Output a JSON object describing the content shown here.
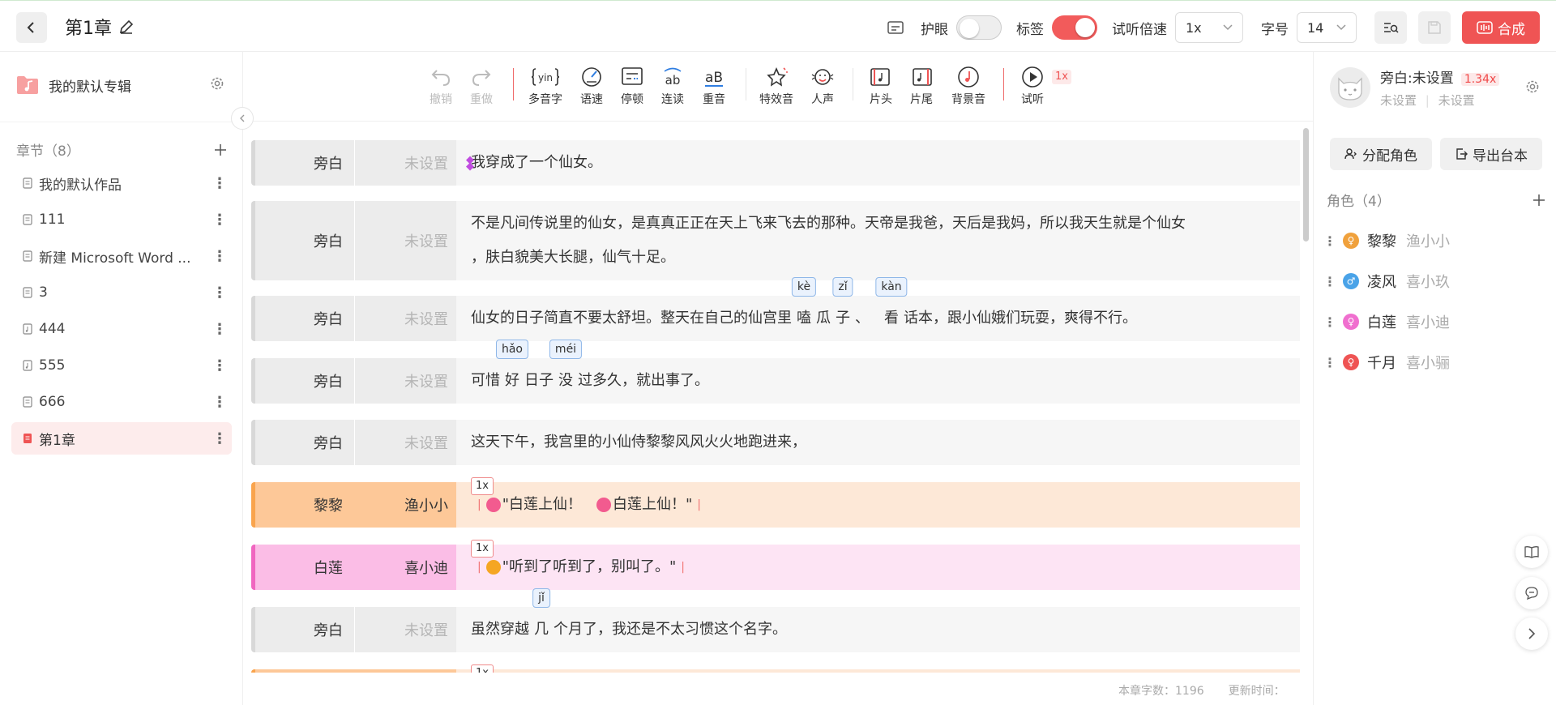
{
  "header": {
    "title": "第1章",
    "eye_label": "护眼",
    "eye_on": false,
    "tag_label": "标签",
    "tag_on": true,
    "speed_label": "试听倍速",
    "speed_value": "1x",
    "font_label": "字号",
    "font_value": "14",
    "synth_label": "合成",
    "accent": "#ef5454"
  },
  "sidebar": {
    "album_name": "我的默认专辑",
    "chapters_label": "章节（8）",
    "chapters": [
      {
        "name": "我的默认作品",
        "active": false
      },
      {
        "name": "111",
        "active": false
      },
      {
        "name": "新建 Microsoft Word ...",
        "active": false
      },
      {
        "name": "3",
        "active": false
      },
      {
        "name": "444",
        "active": false
      },
      {
        "name": "555",
        "active": false
      },
      {
        "name": "666",
        "active": false
      },
      {
        "name": "第1章",
        "active": true
      }
    ]
  },
  "toolbar": {
    "tools": [
      {
        "label": "撤销",
        "icon": "undo-icon",
        "disabled": true
      },
      {
        "label": "重做",
        "icon": "redo-icon",
        "disabled": true
      },
      {
        "label": "多音字",
        "icon": "polyphone-icon",
        "disabled": false
      },
      {
        "label": "语速",
        "icon": "speed-icon",
        "disabled": false
      },
      {
        "label": "停顿",
        "icon": "pause-icon",
        "disabled": false
      },
      {
        "label": "连读",
        "icon": "liaison-icon",
        "disabled": false
      },
      {
        "label": "重音",
        "icon": "stress-icon",
        "disabled": false
      },
      {
        "label": "特效音",
        "icon": "sound-effect-icon",
        "disabled": false
      },
      {
        "label": "人声",
        "icon": "voice-icon",
        "disabled": false
      },
      {
        "label": "片头",
        "icon": "intro-icon",
        "disabled": false
      },
      {
        "label": "片尾",
        "icon": "outro-icon",
        "disabled": false
      },
      {
        "label": "背景音",
        "icon": "bgm-icon",
        "disabled": false
      },
      {
        "label": "试听",
        "icon": "play-icon",
        "disabled": false
      }
    ],
    "preview_speed": "1x"
  },
  "editor": {
    "rows": [
      {
        "role": "旁白",
        "voice": "未设置",
        "style": "gray",
        "text": "我穿成了一个仙女。"
      },
      {
        "role": "旁白",
        "voice": "未设置",
        "style": "gray",
        "text": "不是凡间传说里的仙女，是真真正正在天上飞来飞去的那种。天帝是我爸，天后是我妈，所以我天生就是个仙女",
        "text2": "，肤白貌美大长腿，仙气十足。"
      },
      {
        "role": "旁白",
        "voice": "未设置",
        "style": "gray",
        "text_a": "仙女的日子简直不要太舒坦。整天在自己的仙宫里",
        "py1": "嗑",
        "py1_tag": "kè",
        "text_b": "瓜",
        "py2": "子",
        "py2_tag": "zǐ",
        "text_c": "、",
        "py3": "看",
        "py3_tag": "kàn",
        "text_d": "话本，跟小仙娥们玩耍，爽得不行。"
      },
      {
        "role": "旁白",
        "voice": "未设置",
        "style": "gray",
        "text_a": "可惜",
        "py1": "好",
        "py1_tag": "hǎo",
        "text_b": "日子",
        "py2": "没",
        "py2_tag": "méi",
        "text_c": "过多久，就出事了。"
      },
      {
        "role": "旁白",
        "voice": "未设置",
        "style": "gray",
        "text": "这天下午，我宫里的小仙侍黎黎风风火火地跑进来，"
      },
      {
        "role": "黎黎",
        "voice": "渔小小",
        "style": "orange",
        "speed": "1x",
        "text": "\"白莲上仙！",
        "text2": "白莲上仙！\""
      },
      {
        "role": "白莲",
        "voice": "喜小迪",
        "style": "pink",
        "speed": "1x",
        "text": "\"听到了听到了，别叫了。\""
      },
      {
        "role": "旁白",
        "voice": "未设置",
        "style": "gray",
        "text_a": "虽然穿越",
        "py1": "几",
        "py1_tag": "jǐ",
        "text_b": "个月了，我还是不太习惯这个名字。"
      },
      {
        "role": "",
        "voice": "",
        "style": "orange",
        "speed": "1x",
        "text": ""
      }
    ],
    "footer_count_label": "本章字数：1196",
    "footer_time_label": "更新时间："
  },
  "right_panel": {
    "narrator_name": "旁白:未设置",
    "narrator_speed": "1.34x",
    "narrator_sub1": "未设置",
    "narrator_sub2": "未设置",
    "assign_label": "分配角色",
    "export_label": "导出台本",
    "roles_label": "角色（4）",
    "roles": [
      {
        "name": "黎黎",
        "voice": "渔小小",
        "gender": "female",
        "color": "#f0a13c"
      },
      {
        "name": "凌风",
        "voice": "喜小玖",
        "gender": "male",
        "color": "#4aa3e8"
      },
      {
        "name": "白莲",
        "voice": "喜小迪",
        "gender": "female",
        "color": "#f06fcf"
      },
      {
        "name": "千月",
        "voice": "喜小骊",
        "gender": "female",
        "color": "#ef5454"
      }
    ]
  }
}
